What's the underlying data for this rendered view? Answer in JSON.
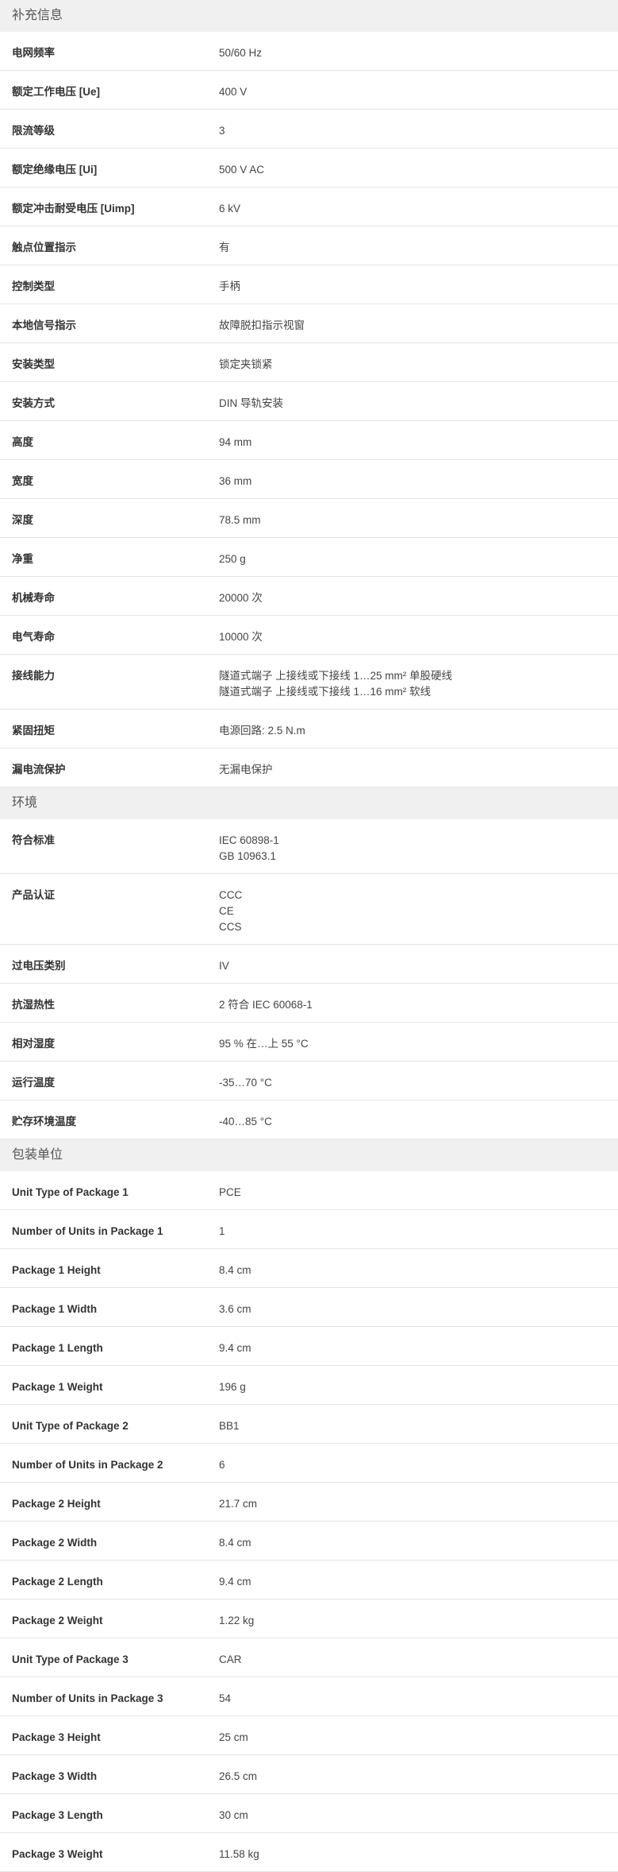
{
  "sections": [
    {
      "title": "补充信息",
      "rows": [
        {
          "label": "电网频率",
          "values": [
            "50/60 Hz"
          ]
        },
        {
          "label": "额定工作电压 [Ue]",
          "values": [
            "400 V"
          ]
        },
        {
          "label": "限流等级",
          "values": [
            "3"
          ]
        },
        {
          "label": "额定绝缘电压 [Ui]",
          "values": [
            "500 V AC"
          ]
        },
        {
          "label": "额定冲击耐受电压 [Uimp]",
          "values": [
            "6 kV"
          ]
        },
        {
          "label": "触点位置指示",
          "values": [
            "有"
          ]
        },
        {
          "label": "控制类型",
          "values": [
            "手柄"
          ]
        },
        {
          "label": "本地信号指示",
          "values": [
            "故障脱扣指示视窗"
          ]
        },
        {
          "label": "安装类型",
          "values": [
            "锁定夹锁紧"
          ]
        },
        {
          "label": "安装方式",
          "values": [
            "DIN 导轨安装"
          ]
        },
        {
          "label": "高度",
          "values": [
            "94 mm"
          ]
        },
        {
          "label": "宽度",
          "values": [
            "36 mm"
          ]
        },
        {
          "label": "深度",
          "values": [
            "78.5 mm"
          ]
        },
        {
          "label": "净重",
          "values": [
            "250 g"
          ]
        },
        {
          "label": "机械寿命",
          "values": [
            "20000 次"
          ]
        },
        {
          "label": "电气寿命",
          "values": [
            "10000 次"
          ]
        },
        {
          "label": "接线能力",
          "values": [
            "隧道式端子 上接线或下接线 1…25 mm² 单股硬线",
            "隧道式端子 上接线或下接线 1…16 mm² 软线"
          ]
        },
        {
          "label": "紧固扭矩",
          "values": [
            "电源回路: 2.5 N.m"
          ]
        },
        {
          "label": "漏电流保护",
          "values": [
            "无漏电保护"
          ]
        }
      ]
    },
    {
      "title": "环境",
      "rows": [
        {
          "label": "符合标准",
          "values": [
            "IEC 60898-1",
            "GB 10963.1"
          ]
        },
        {
          "label": "产品认证",
          "values": [
            "CCC",
            "CE",
            "CCS"
          ]
        },
        {
          "label": "过电压类别",
          "values": [
            "IV"
          ]
        },
        {
          "label": "抗湿热性",
          "values": [
            "2 符合 IEC 60068-1"
          ]
        },
        {
          "label": "相对湿度",
          "values": [
            "95 % 在…上 55 °C"
          ]
        },
        {
          "label": "运行温度",
          "values": [
            "-35…70 °C"
          ]
        },
        {
          "label": "贮存环境温度",
          "values": [
            "-40…85 °C"
          ]
        }
      ]
    },
    {
      "title": "包装单位",
      "rows": [
        {
          "label": "Unit Type of Package 1",
          "values": [
            "PCE"
          ]
        },
        {
          "label": "Number of Units in Package 1",
          "values": [
            "1"
          ]
        },
        {
          "label": "Package 1 Height",
          "values": [
            "8.4 cm"
          ]
        },
        {
          "label": "Package 1 Width",
          "values": [
            "3.6 cm"
          ]
        },
        {
          "label": "Package 1 Length",
          "values": [
            "9.4 cm"
          ]
        },
        {
          "label": "Package 1 Weight",
          "values": [
            "196 g"
          ]
        },
        {
          "label": "Unit Type of Package 2",
          "values": [
            "BB1"
          ]
        },
        {
          "label": "Number of Units in Package 2",
          "values": [
            "6"
          ]
        },
        {
          "label": "Package 2 Height",
          "values": [
            "21.7 cm"
          ]
        },
        {
          "label": "Package 2 Width",
          "values": [
            "8.4 cm"
          ]
        },
        {
          "label": "Package 2 Length",
          "values": [
            "9.4 cm"
          ]
        },
        {
          "label": "Package 2 Weight",
          "values": [
            "1.22 kg"
          ]
        },
        {
          "label": "Unit Type of Package 3",
          "values": [
            "CAR"
          ]
        },
        {
          "label": "Number of Units in Package 3",
          "values": [
            "54"
          ]
        },
        {
          "label": "Package 3 Height",
          "values": [
            "25 cm"
          ]
        },
        {
          "label": "Package 3 Width",
          "values": [
            "26.5 cm"
          ]
        },
        {
          "label": "Package 3 Length",
          "values": [
            "30 cm"
          ]
        },
        {
          "label": "Package 3 Weight",
          "values": [
            "11.58 kg"
          ]
        }
      ]
    }
  ]
}
